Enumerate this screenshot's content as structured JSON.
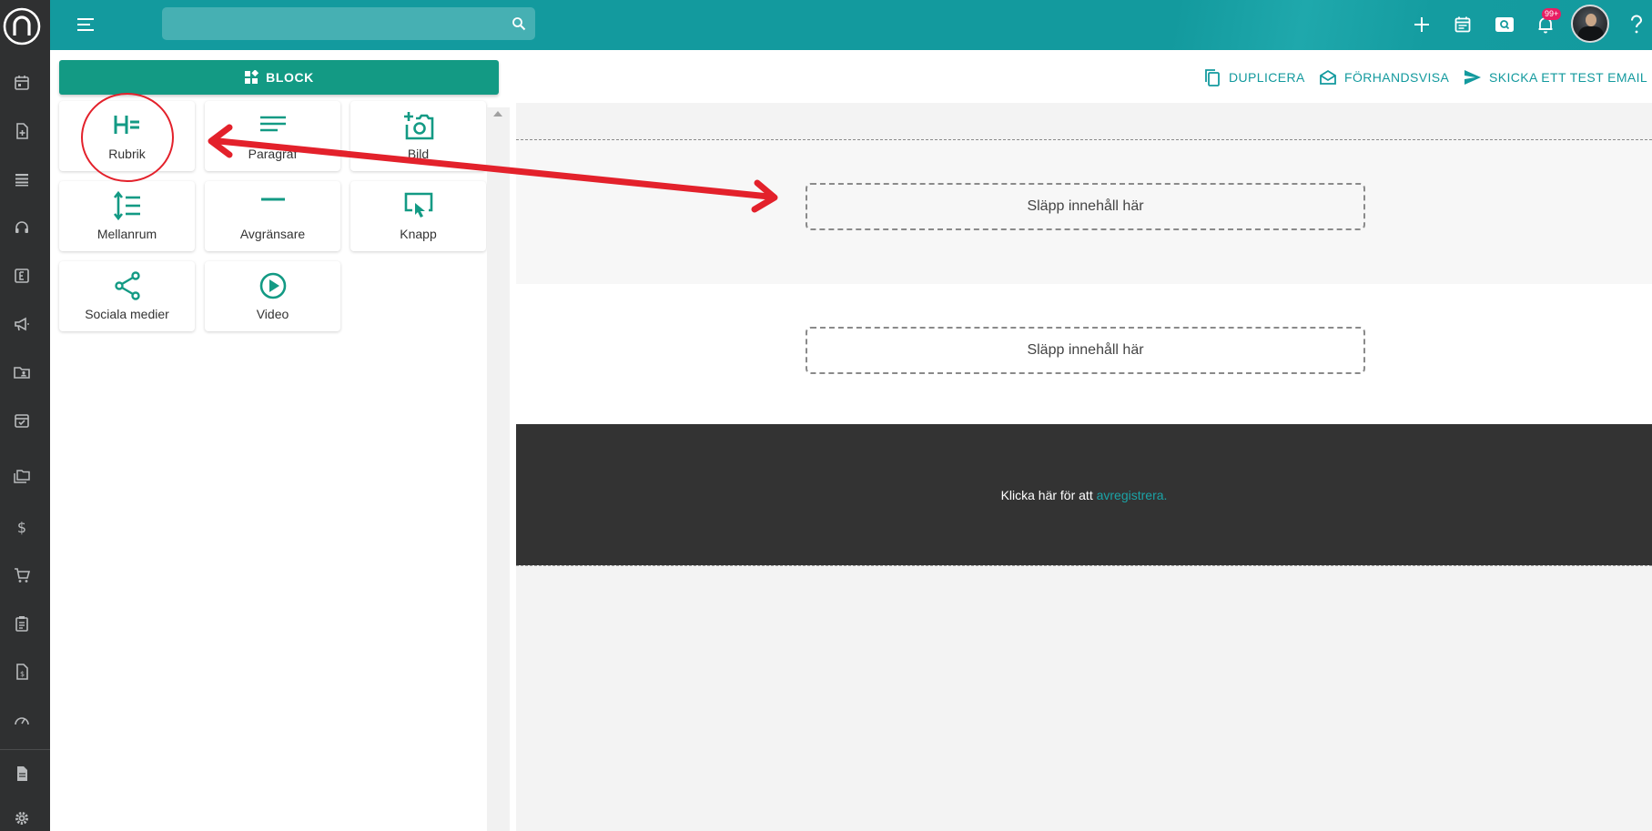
{
  "app": {
    "logo_name": "n-logo",
    "accent_color": "#139a9e",
    "button_color": "#139a84"
  },
  "sidebar": {
    "icons": [
      "calendar-icon",
      "document-add-icon",
      "list-icon",
      "headset-icon",
      "article-icon",
      "megaphone-icon",
      "folder-account-icon",
      "calendar-check-icon",
      "folders-icon",
      "dollar-icon",
      "cart-icon",
      "clipboard-icon",
      "invoice-icon",
      "gauge-icon",
      "file-icon",
      "gear-icon"
    ]
  },
  "topbar": {
    "search_placeholder": "",
    "notification_badge": "99+"
  },
  "panel": {
    "block_label": "BLOCK",
    "tiles": [
      {
        "label": "Rubrik",
        "icon": "heading-icon"
      },
      {
        "label": "Paragraf",
        "icon": "paragraph-icon"
      },
      {
        "label": "Bild",
        "icon": "add-photo-icon"
      },
      {
        "label": "Mellanrum",
        "icon": "spacing-icon"
      },
      {
        "label": "Avgränsare",
        "icon": "divider-icon"
      },
      {
        "label": "Knapp",
        "icon": "button-click-icon"
      },
      {
        "label": "Sociala medier",
        "icon": "share-icon"
      },
      {
        "label": "Video",
        "icon": "play-icon"
      }
    ]
  },
  "toolbar": {
    "duplicate_label": "DUPLICERA",
    "preview_label": "FÖRHANDSVISA",
    "test_email_label": "SKICKA ETT TEST EMAIL"
  },
  "canvas": {
    "drop_zone_1": "Släpp innehåll här",
    "drop_zone_2": "Släpp innehåll här",
    "footer_text": "Klicka här för att ",
    "footer_link": "avregistrera."
  },
  "annotation": {
    "color": "#e3212b"
  }
}
